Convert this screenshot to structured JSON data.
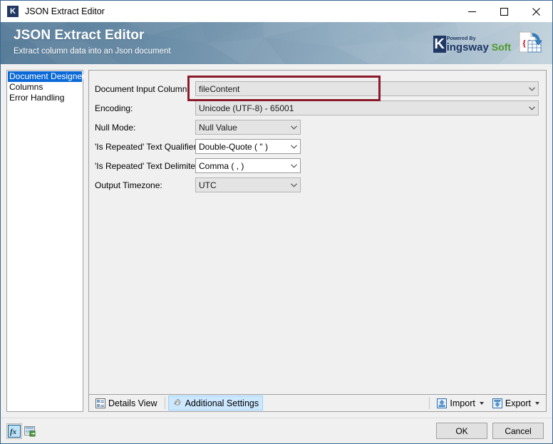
{
  "window": {
    "app_icon_letter": "K",
    "title": "JSON Extract Editor",
    "minimize_label": "minimize",
    "maximize_label": "maximize",
    "close_label": "close"
  },
  "banner": {
    "title": "JSON Extract Editor",
    "subtitle": "Extract column data into an Json document",
    "logo": {
      "k_letter": "K",
      "powered_by": "Powered By",
      "kingsway": "ingsway",
      "soft": "Soft"
    },
    "product_icon_name": "json-document-icon",
    "json_braces": "{ }"
  },
  "nav": {
    "items": [
      {
        "label": "Document Designer",
        "selected": true
      },
      {
        "label": "Columns",
        "selected": false
      },
      {
        "label": "Error Handling",
        "selected": false
      }
    ]
  },
  "form": {
    "rows": [
      {
        "label": "Document Input Column:",
        "value": "fileContent",
        "disabled": true,
        "wide": true,
        "highlighted": true
      },
      {
        "label": "Encoding:",
        "value": "Unicode (UTF-8) - 65001",
        "disabled": true,
        "wide": true,
        "highlighted": false
      },
      {
        "label": "Null Mode:",
        "value": "Null Value",
        "disabled": true,
        "wide": false,
        "highlighted": false
      },
      {
        "label": "'Is Repeated' Text Qualifier:",
        "value": "Double-Quote ( \" )",
        "disabled": false,
        "wide": false,
        "highlighted": false
      },
      {
        "label": "'Is Repeated' Text Delimiter:",
        "value": "Comma ( , )",
        "disabled": false,
        "wide": false,
        "highlighted": false
      },
      {
        "label": "Output Timezone:",
        "value": "UTC",
        "disabled": true,
        "wide": false,
        "highlighted": false
      }
    ]
  },
  "tabbar": {
    "details_view": "Details View",
    "details_view_icon": "details-list-icon",
    "additional_settings": "Additional Settings",
    "additional_settings_icon": "gear-icon",
    "import": "Import",
    "import_icon": "import-arrow-icon",
    "export": "Export",
    "export_icon": "export-arrow-icon"
  },
  "footer": {
    "expression_icon": "fx-expression-icon",
    "variables_icon": "grid-variables-icon",
    "ok": "OK",
    "cancel": "Cancel"
  },
  "colors": {
    "selection_blue": "#0a69d6",
    "tab_active_blue": "#cce8ff",
    "highlight_red": "#8b1a2b",
    "banner_dark": "#5b7f9c",
    "banner_light": "#c3d2dc",
    "brand_navy": "#1f3864",
    "brand_green": "#4d9a28",
    "window_border": "#3a6a94"
  }
}
